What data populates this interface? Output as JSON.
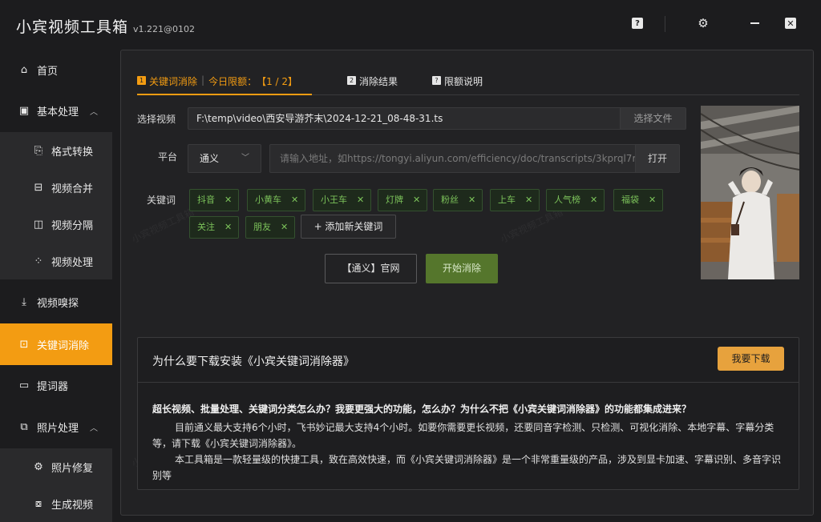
{
  "app": {
    "title": "小宾视频工具箱",
    "version": "v1.221@0102",
    "help_label": "?",
    "close_label": "✕"
  },
  "sidebar": {
    "items": [
      {
        "label": "首页",
        "icon": "home-icon"
      },
      {
        "label": "基本处理",
        "icon": "video-icon",
        "expanded": true
      },
      {
        "label": "格式转换",
        "icon": "file-convert-icon"
      },
      {
        "label": "视频合并",
        "icon": "merge-icon"
      },
      {
        "label": "视频分隔",
        "icon": "split-icon"
      },
      {
        "label": "视频处理",
        "icon": "process-icon"
      },
      {
        "label": "视频嗅探",
        "icon": "download-icon"
      },
      {
        "label": "关键词消除",
        "icon": "keyword-icon",
        "active": true
      },
      {
        "label": "提词器",
        "icon": "teleprompter-icon"
      },
      {
        "label": "照片处理",
        "icon": "photo-icon",
        "expanded": true
      },
      {
        "label": "照片修复",
        "icon": "repair-icon"
      },
      {
        "label": "生成视频",
        "icon": "generate-video-icon"
      }
    ]
  },
  "tabs": [
    {
      "num": "1",
      "label": "关键词消除",
      "active": true
    },
    {
      "num": "2",
      "label": "消除结果"
    },
    {
      "num": "?",
      "label": "限额说明"
    }
  ],
  "quota": {
    "label": "今日限额：",
    "value": "【1 / 2】"
  },
  "form": {
    "video_label": "选择视频",
    "video_path": "F:\\temp\\video\\西安导游芥末\\2024-12-21_08-48-31.ts",
    "pick_file_label": "选择文件",
    "platform_label": "平台",
    "platform_value": "通义",
    "url_placeholder": "请输入地址，如https://tongyi.aliyun.com/efficiency/doc/transcripts/3kprql7r",
    "open_label": "打开",
    "keywords_label": "关键词",
    "keywords": [
      "抖音",
      "小黄车",
      "小王车",
      "灯牌",
      "粉丝",
      "上车",
      "人气榜",
      "福袋",
      "关注",
      "朋友"
    ],
    "add_keyword_label": "+ 添加新关键词",
    "site_button": "【通义】官网",
    "start_button": "开始消除"
  },
  "info": {
    "title": "为什么要下载安装《小宾关键词消除器》",
    "download_button": "我要下载",
    "question": "超长视频、批量处理、关键词分类怎么办？我要更强大的功能，怎么办？为什么不把《小宾关键词消除器》的功能都集成进来？",
    "paragraph1": "目前通义最大支持6个小时，飞书妙记最大支持4个小时。如要你需要更长视频，还要同音字检测、只检测、可视化消除、本地字幕、字幕分类等，请下载《小宾关键词消除器》。",
    "paragraph2": "本工具箱是一款轻量级的快捷工具，致在高效快速，而《小宾关键词消除器》是一个非常重量级的产品，涉及到显卡加速、字幕识别、多音字识别等"
  },
  "colors": {
    "accent": "#f39c12",
    "keyword_chip_text": "#7cc35a",
    "start_button": "#55762c",
    "download_button": "#e7a23d"
  }
}
